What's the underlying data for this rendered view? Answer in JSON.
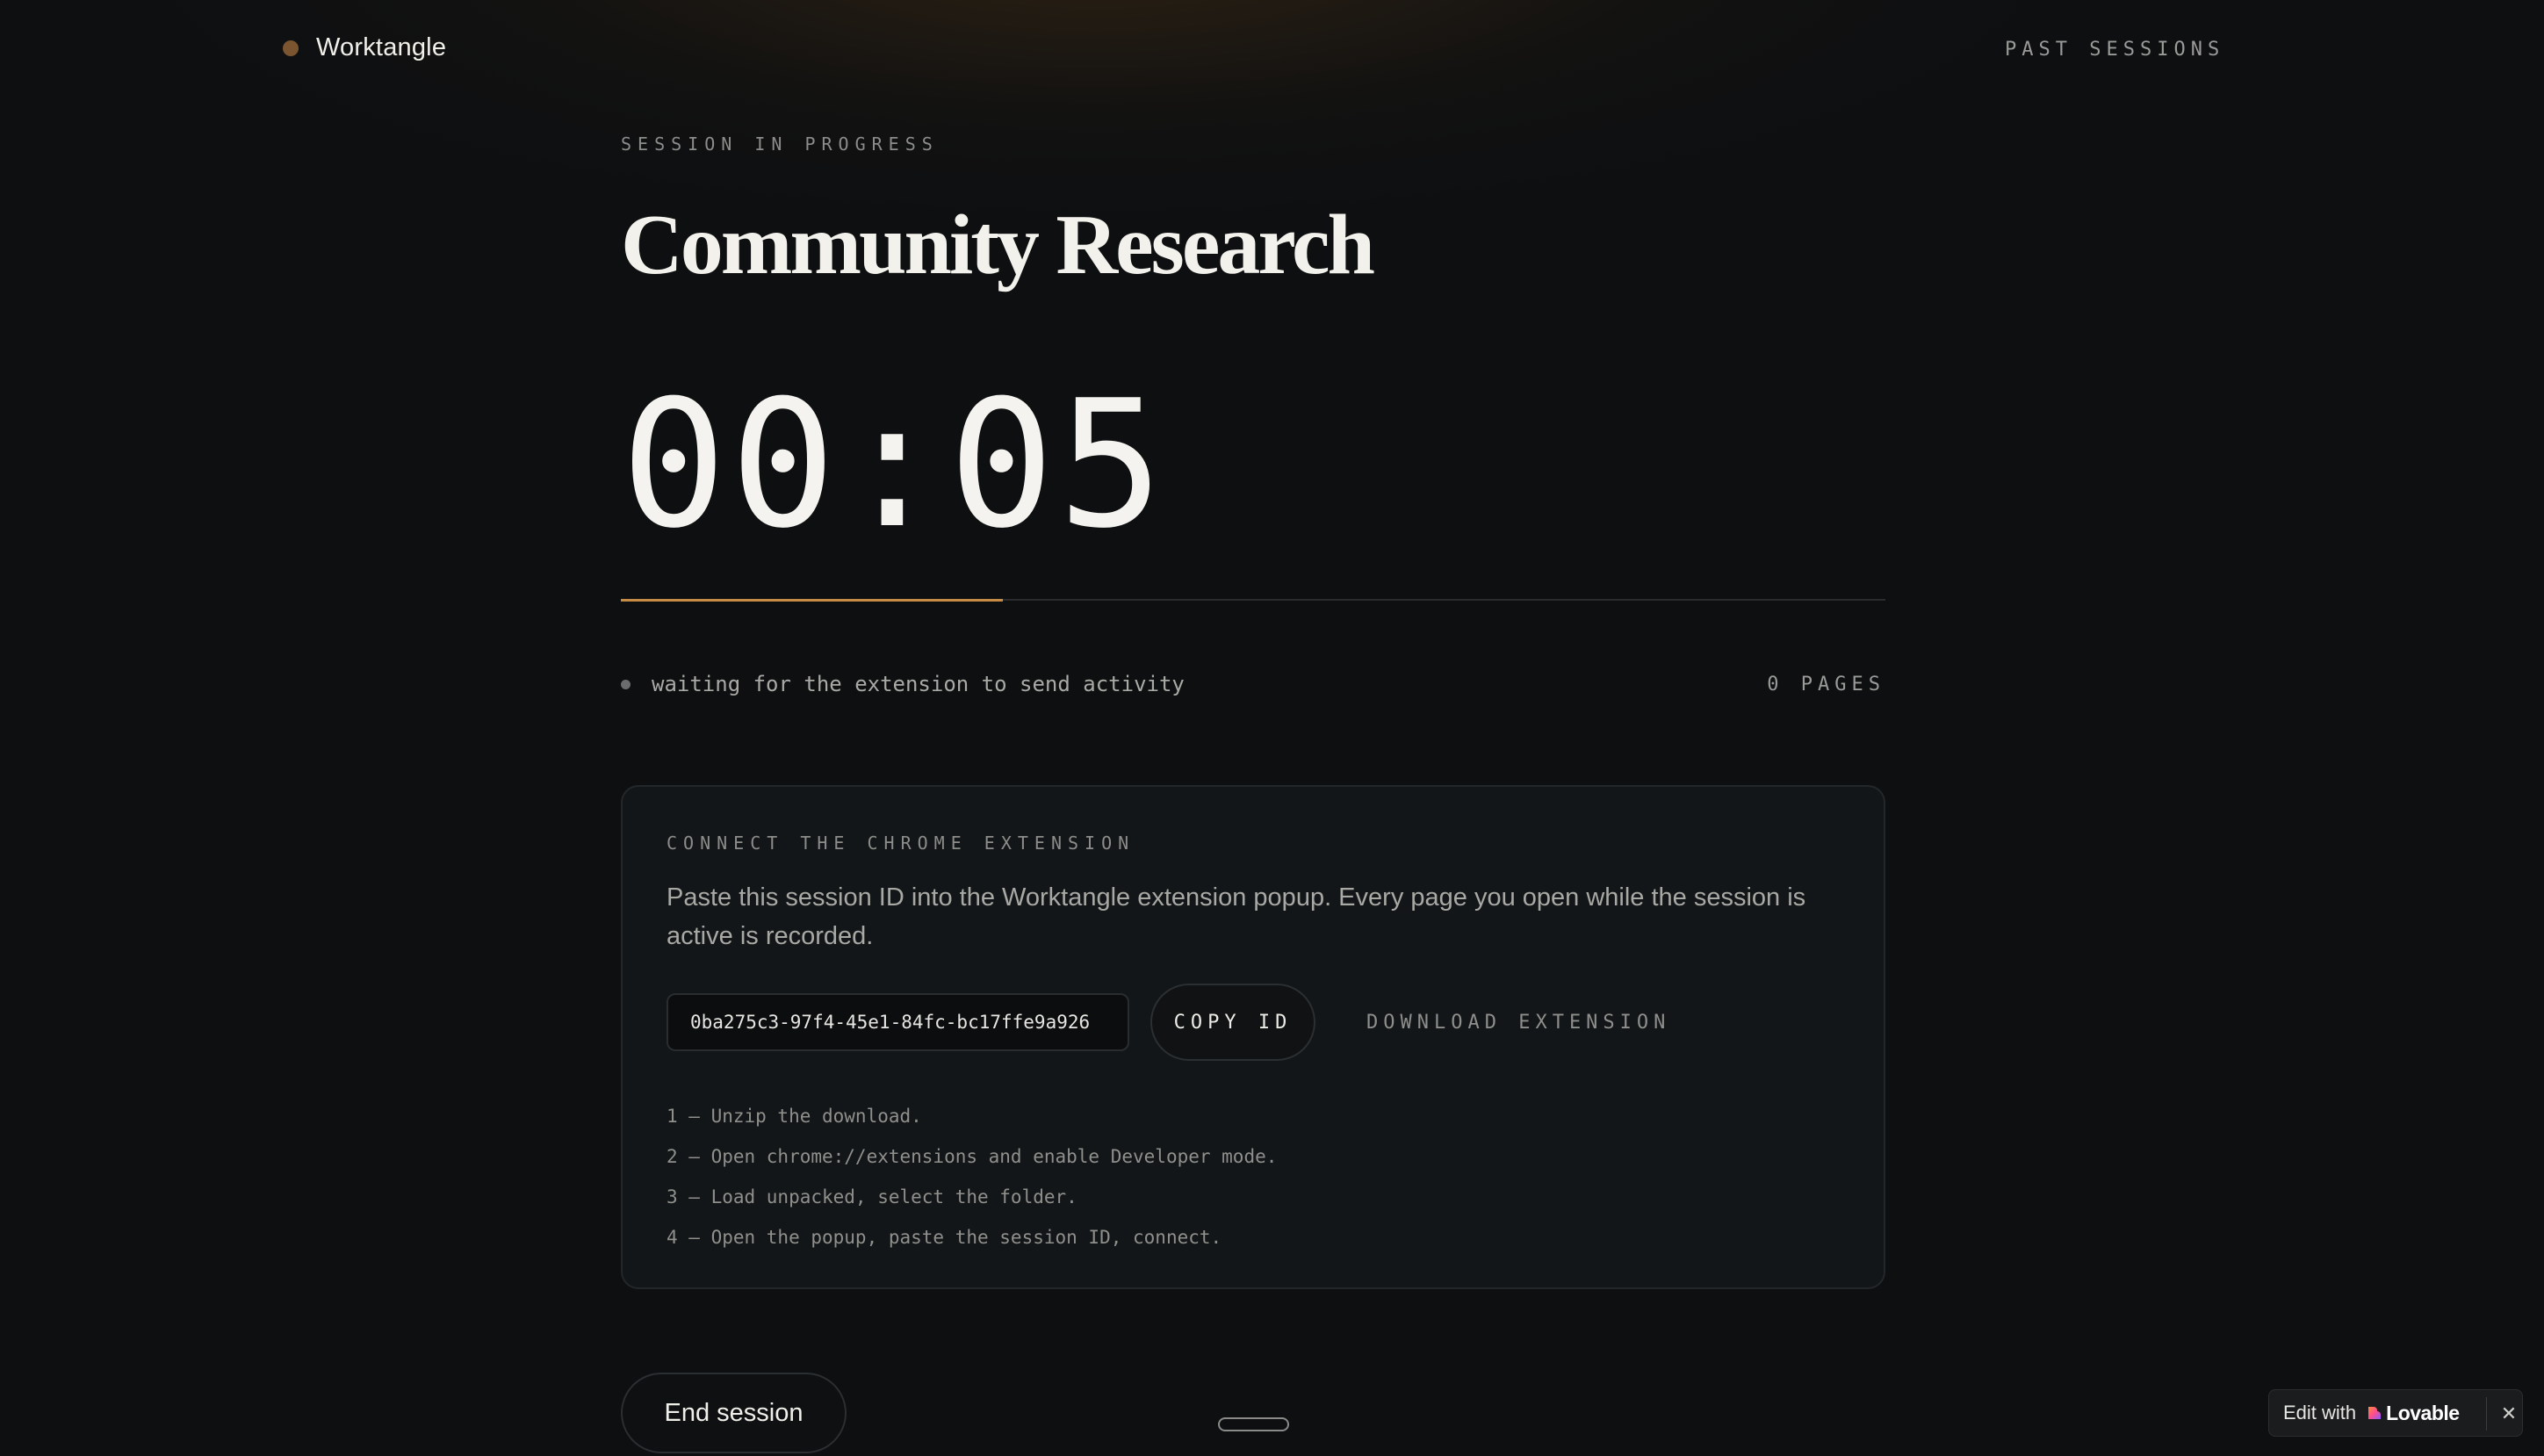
{
  "header": {
    "brand_name": "Worktangle",
    "past_sessions_label": "PAST SESSIONS"
  },
  "session": {
    "eyebrow": "SESSION IN PROGRESS",
    "title": "Community Research",
    "timer": "00:05",
    "progress_fraction": 0.302,
    "status_text": "waiting for the extension to send activity",
    "pages_count": "0 PAGES"
  },
  "extension_card": {
    "eyebrow": "CONNECT THE CHROME EXTENSION",
    "description": "Paste this session ID into the Worktangle extension popup. Every page you open while the session is active is recorded.",
    "session_id": "0ba275c3-97f4-45e1-84fc-bc17ffe9a926",
    "copy_label": "COPY ID",
    "download_label": "DOWNLOAD EXTENSION",
    "steps": [
      "1 — Unzip the download.",
      "2 — Open chrome://extensions and enable Developer mode.",
      "3 — Load unpacked, select the folder.",
      "4 — Open the popup, paste the session ID, connect."
    ]
  },
  "actions": {
    "end_session_label": "End session"
  },
  "badge": {
    "edit_with_label": "Edit with",
    "brand_label": "Lovable",
    "close_glyph": "✕"
  },
  "colors": {
    "accent": "#c68b45",
    "brand_dot": "#7a5530",
    "background": "#0d0f11"
  }
}
